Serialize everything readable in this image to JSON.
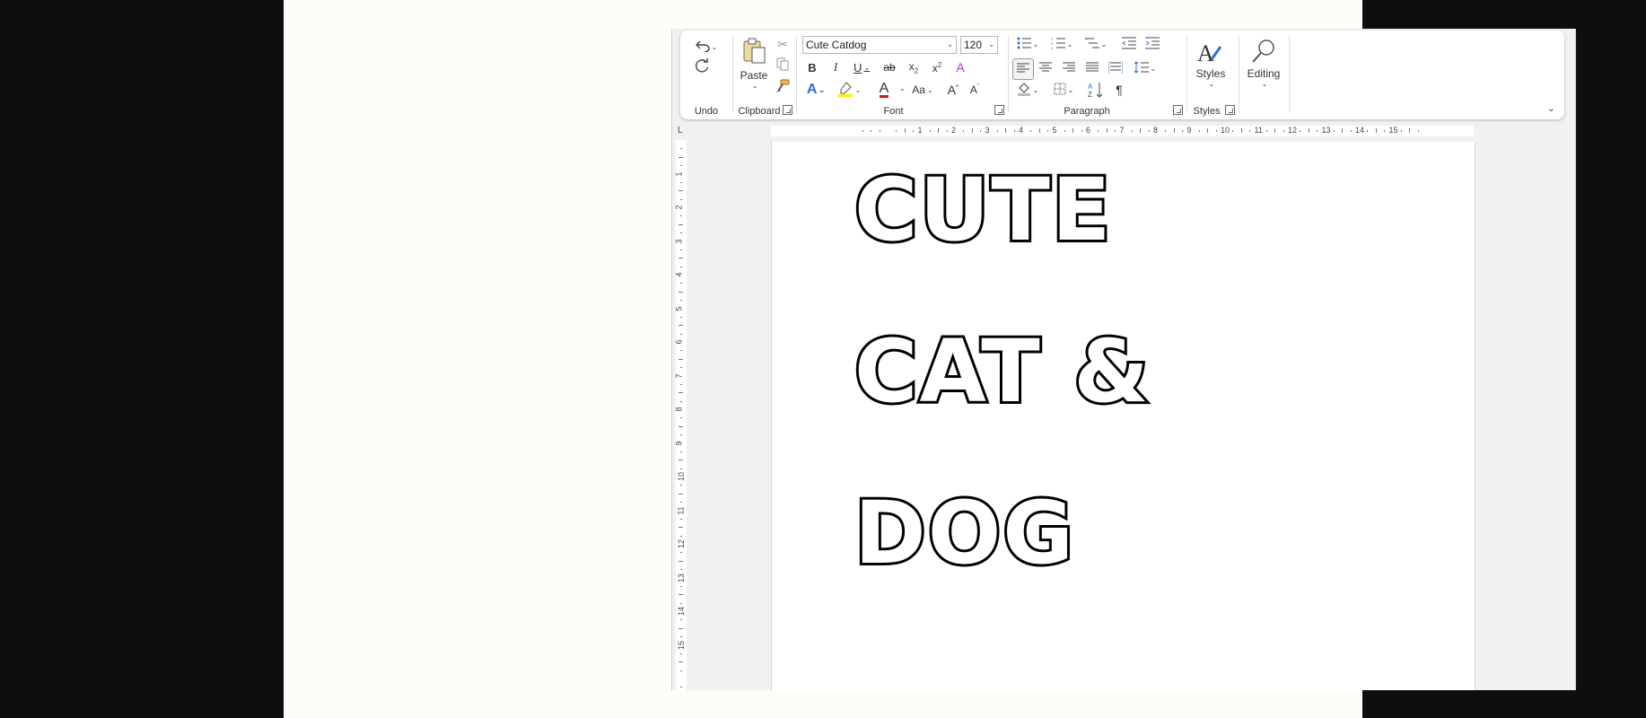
{
  "ribbon": {
    "undo": {
      "label": "Undo"
    },
    "clipboard": {
      "label": "Clipboard",
      "paste_label": "Paste"
    },
    "font": {
      "label": "Font",
      "font_name": "Cute Catdog",
      "font_size": "120",
      "case_label": "Aa"
    },
    "paragraph": {
      "label": "Paragraph"
    },
    "styles": {
      "label": "Styles",
      "styles_label": "Styles"
    },
    "editing": {
      "label": "Editing"
    }
  },
  "ruler": {
    "h_numbers": [
      "1",
      "2",
      "3",
      "4",
      "5",
      "6",
      "7",
      "8",
      "9",
      "10",
      "11",
      "12",
      "13",
      "14",
      "15"
    ],
    "v_numbers": [
      "1",
      "2",
      "3",
      "4",
      "5",
      "6",
      "7",
      "8",
      "9",
      "10",
      "11",
      "12",
      "13",
      "14",
      "15"
    ]
  },
  "document": {
    "lines": [
      "CUTE",
      "CAT &",
      "DOG"
    ]
  }
}
